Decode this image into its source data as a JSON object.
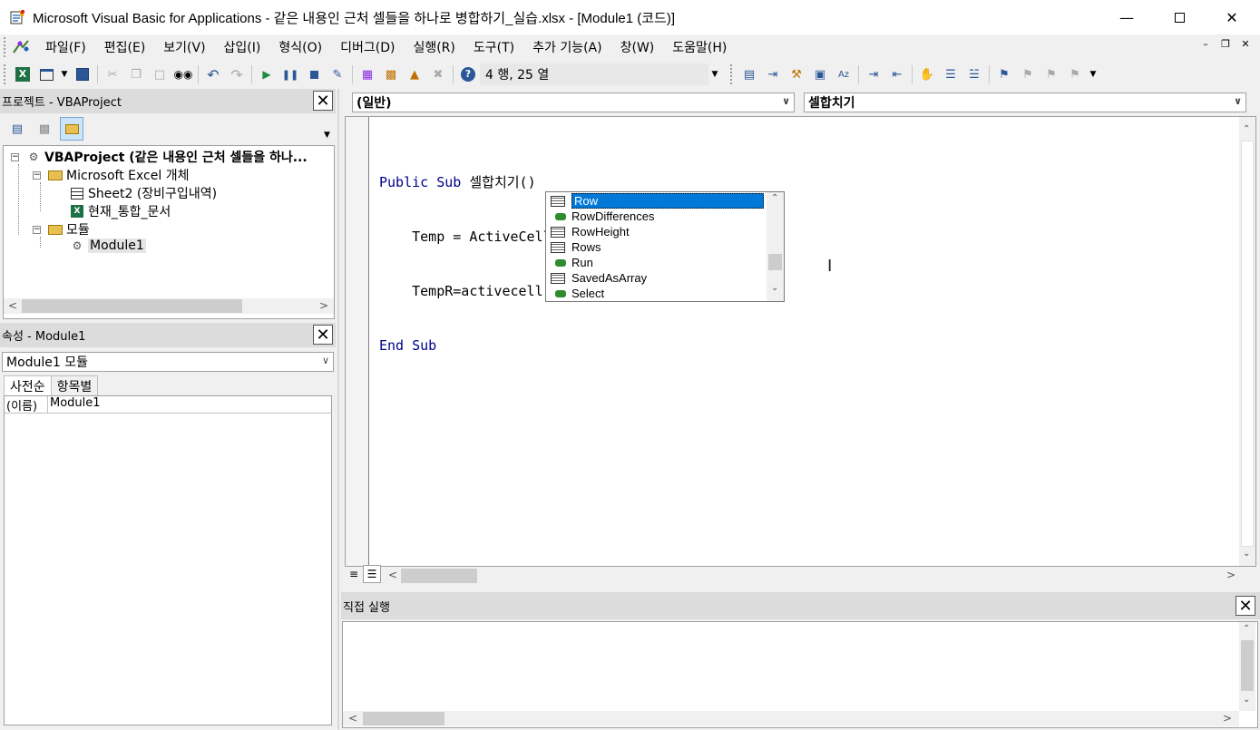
{
  "window": {
    "title": "Microsoft Visual Basic for Applications - 같은 내용인 근처 셀들을 하나로 병합하기_실습.xlsx - [Module1 (코드)]",
    "minimize_icon": "minimize-icon",
    "maximize_icon": "maximize-icon",
    "close_icon": "close-icon"
  },
  "menu": [
    "파일(F)",
    "편집(E)",
    "보기(V)",
    "삽입(I)",
    "형식(O)",
    "디버그(D)",
    "실행(R)",
    "도구(T)",
    "추가 기능(A)",
    "창(W)",
    "도움말(H)"
  ],
  "toolbar": {
    "position_label": "4 행, 25 열"
  },
  "project_pane": {
    "title": "프로젝트 - VBAProject",
    "tree": {
      "root": "VBAProject (같은 내용인 근처 셀들을 하나...",
      "excel_objects": "Microsoft Excel 개체",
      "sheet2": "Sheet2 (장비구입내역)",
      "workbook": "현재_통합_문서",
      "modules": "모듈",
      "module1": "Module1"
    }
  },
  "properties_pane": {
    "title": "속성 - Module1",
    "object_select": "Module1 모듈",
    "tabs": [
      "사전순",
      "항목별"
    ],
    "rows": [
      {
        "name": "(이름)",
        "value": "Module1"
      }
    ]
  },
  "code_window": {
    "object_combo": "(일반)",
    "procedure_combo": "셀합치기",
    "lines": [
      {
        "kw1": "Public Sub",
        "rest": " 셀합치기()"
      },
      {
        "indent": "    ",
        "text": "Temp = ActiveCell"
      },
      {
        "indent": "    ",
        "text": "TempR=activecell.row"
      },
      {
        "kw1": "End Sub",
        "rest": ""
      }
    ]
  },
  "autocomplete": {
    "items": [
      {
        "label": "Row",
        "icon": "property-icon",
        "selected": true
      },
      {
        "label": "RowDifferences",
        "icon": "method-icon",
        "selected": false
      },
      {
        "label": "RowHeight",
        "icon": "property-icon",
        "selected": false
      },
      {
        "label": "Rows",
        "icon": "property-icon",
        "selected": false
      },
      {
        "label": "Run",
        "icon": "method-icon",
        "selected": false
      },
      {
        "label": "SavedAsArray",
        "icon": "property-icon",
        "selected": false
      },
      {
        "label": "Select",
        "icon": "method-icon",
        "selected": false
      }
    ]
  },
  "immediate_pane": {
    "title": "직접 실행"
  },
  "colors": {
    "keyword": "#00008b",
    "selection": "#0078d7"
  }
}
